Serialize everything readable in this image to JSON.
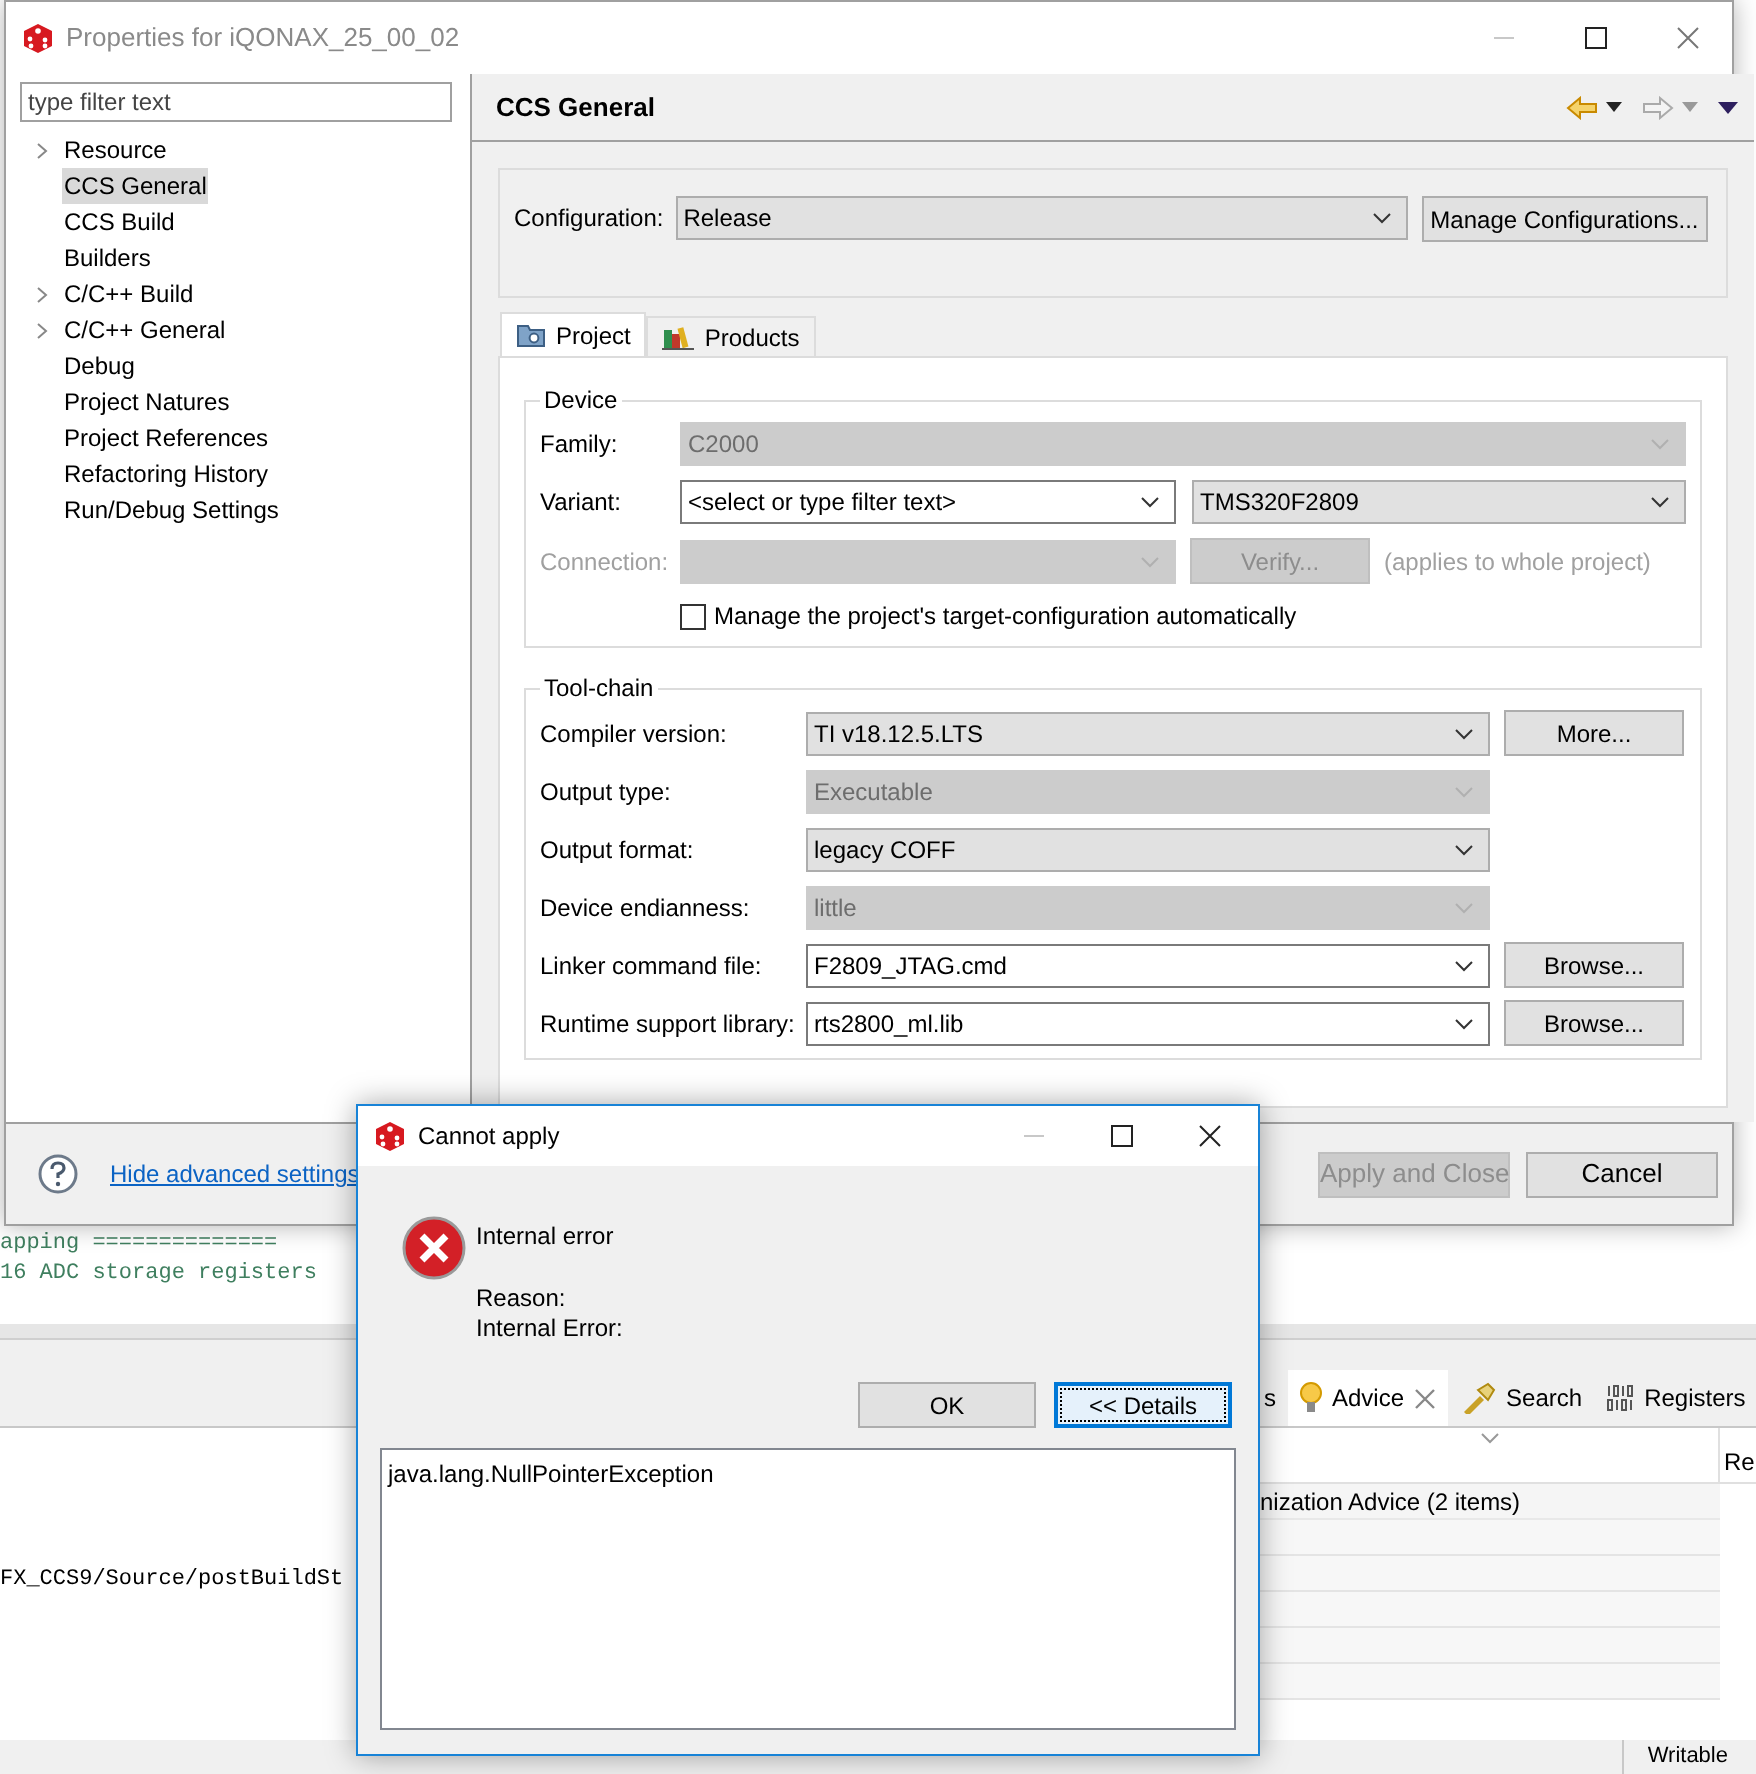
{
  "background_ide": {
    "code_lines": [
      "apping ==============",
      "16 ADC storage registers"
    ],
    "path_text": "FX_CCS9/Source/postBuildSt",
    "view_tabs": [
      {
        "label": "s",
        "selected": false,
        "kind": "plain"
      },
      {
        "label": "Advice",
        "selected": true,
        "kind": "advice"
      },
      {
        "label": "Search",
        "selected": false,
        "kind": "search"
      },
      {
        "label": "Registers",
        "selected": false,
        "kind": "registers"
      }
    ],
    "table": {
      "column_2": "Re",
      "rows": [
        "nization Advice (2 items)"
      ]
    },
    "status_bar": "Writable"
  },
  "properties_window": {
    "title": "Properties for iQONAX_25_00_02",
    "filter": {
      "placeholder": "type filter text"
    },
    "tree": [
      {
        "label": "Resource",
        "expandable": true,
        "selected": false
      },
      {
        "label": "CCS General",
        "expandable": false,
        "selected": true
      },
      {
        "label": "CCS Build",
        "expandable": false,
        "selected": false
      },
      {
        "label": "Builders",
        "expandable": false,
        "selected": false
      },
      {
        "label": "C/C++ Build",
        "expandable": true,
        "selected": false
      },
      {
        "label": "C/C++ General",
        "expandable": true,
        "selected": false
      },
      {
        "label": "Debug",
        "expandable": false,
        "selected": false
      },
      {
        "label": "Project Natures",
        "expandable": false,
        "selected": false
      },
      {
        "label": "Project References",
        "expandable": false,
        "selected": false
      },
      {
        "label": "Refactoring History",
        "expandable": false,
        "selected": false
      },
      {
        "label": "Run/Debug Settings",
        "expandable": false,
        "selected": false
      }
    ],
    "page_title": "CCS General",
    "configuration": {
      "label": "Configuration:",
      "value": "Release",
      "button": "Manage Configurations..."
    },
    "tabs": [
      {
        "label": "Project",
        "selected": true,
        "kind": "project"
      },
      {
        "label": "Products",
        "selected": false,
        "kind": "products"
      }
    ],
    "device": {
      "title": "Device",
      "family": {
        "label": "Family:",
        "value": "C2000",
        "disabled": true
      },
      "variant": {
        "label": "Variant:",
        "filter_value": "<select or type filter text>",
        "value": "TMS320F2809"
      },
      "connection": {
        "label": "Connection:",
        "disabled": true,
        "button": "Verify...",
        "note": "(applies to whole project)"
      },
      "manage_checkbox": {
        "label": "Manage the project's target-configuration automatically",
        "checked": false
      }
    },
    "toolchain": {
      "title": "Tool-chain",
      "rows": [
        {
          "label": "Compiler version:",
          "value": "TI v18.12.5.LTS",
          "disabled": false,
          "editable": false,
          "button": "More..."
        },
        {
          "label": "Output type:",
          "value": "Executable",
          "disabled": true,
          "editable": false
        },
        {
          "label": "Output format:",
          "value": "legacy COFF",
          "disabled": false,
          "editable": false
        },
        {
          "label": "Device endianness:",
          "value": "little",
          "disabled": true,
          "editable": false
        },
        {
          "label": "Linker command file:",
          "value": "F2809_JTAG.cmd",
          "disabled": false,
          "editable": true,
          "button": "Browse..."
        },
        {
          "label": "Runtime support library:",
          "value": "rts2800_ml.lib",
          "disabled": false,
          "editable": true,
          "button": "Browse..."
        }
      ]
    },
    "help_link": "Hide advanced settings",
    "buttons": [
      {
        "label": "Apply and Close",
        "disabled": true
      },
      {
        "label": "Cancel",
        "disabled": false
      }
    ]
  },
  "error_dialog": {
    "title": "Cannot apply",
    "message": "Internal error",
    "reason_lines": [
      "Reason:",
      "Internal Error:"
    ],
    "buttons": [
      {
        "label": "OK",
        "focused": false
      },
      {
        "label": "<< Details",
        "focused": true
      }
    ],
    "details": "java.lang.NullPointerException"
  }
}
